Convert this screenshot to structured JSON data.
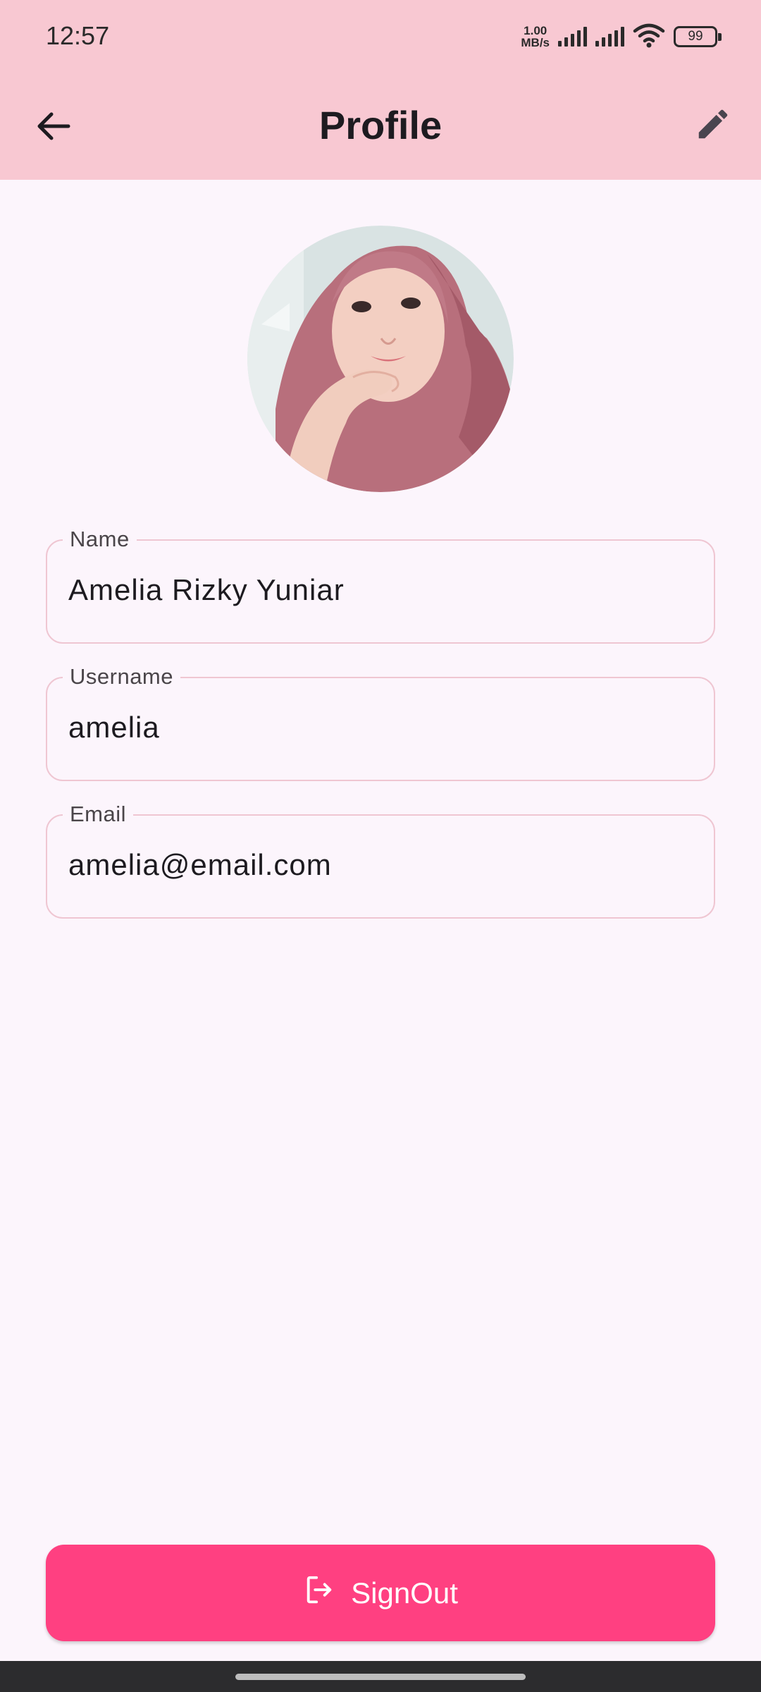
{
  "status_bar": {
    "time": "12:57",
    "net_speed_value": "1.00",
    "net_speed_unit": "MB/s",
    "battery": "99"
  },
  "app_bar": {
    "title": "Profile",
    "back_icon": "arrow-back-icon",
    "edit_icon": "pencil-icon"
  },
  "profile": {
    "avatar_icon": "profile-photo"
  },
  "fields": {
    "name": {
      "label": "Name",
      "value": "Amelia Rizky Yuniar"
    },
    "username": {
      "label": "Username",
      "value": "amelia"
    },
    "email": {
      "label": "Email",
      "value": "amelia@email.com"
    }
  },
  "signout": {
    "label": "SignOut",
    "icon": "logout-icon"
  },
  "colors": {
    "app_bar_bg": "#F8C8D2",
    "page_bg": "#FCF5FC",
    "field_border": "#EFC6D2",
    "accent": "#FF4081"
  }
}
